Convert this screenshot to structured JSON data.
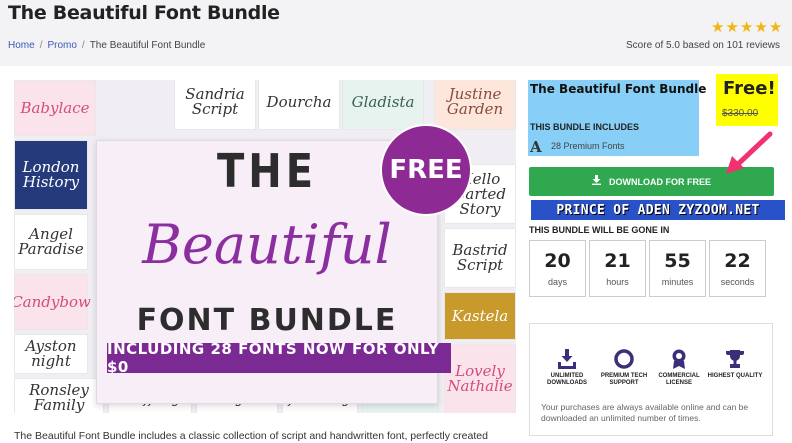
{
  "page": {
    "title": "The Beautiful Font Bundle",
    "rating_stars": 5,
    "score_text": "Score of 5.0 based on 101 reviews"
  },
  "breadcrumb": [
    "Home",
    "Promo",
    "The Beautiful Font Bundle"
  ],
  "promo_image": {
    "line1": "THE",
    "line2": "Beautiful",
    "line3": "FONT BUNDLE",
    "banner": "INCLUDING 28 FONTS NOW FOR ONLY $0",
    "badge": "FREE",
    "tiles": [
      "Babylace",
      "Sandria Script",
      "Dourcha",
      "Gladista",
      "Justine Garden",
      "London History",
      "Angel Paradise",
      "Candybow",
      "Hello Carted Story",
      "Bastrid Script",
      "Ayston night",
      "Kastela",
      "Ronsley Family",
      "Shiffany",
      "Abiyah",
      "fair lady",
      "Baby Dualistic",
      "Lovely Nathalie"
    ]
  },
  "bundle": {
    "title": "The Beautiful Font Bundle",
    "includes_label": "THIS BUNDLE INCLUDES",
    "fonts_icon": "A",
    "fonts_count": "28 Premium Fonts",
    "price_free": "Free!",
    "price_old": "$330.00",
    "download_label": "DOWNLOAD FOR FREE",
    "download_icon": "download-icon",
    "watermark": "PRINCE OF ADEN ZYZOOM.NET",
    "gone_label": "THIS BUNDLE WILL BE GONE IN",
    "countdown": [
      {
        "value": "20",
        "unit": "days"
      },
      {
        "value": "21",
        "unit": "hours"
      },
      {
        "value": "55",
        "unit": "minutes"
      },
      {
        "value": "22",
        "unit": "seconds"
      }
    ]
  },
  "features": [
    {
      "label": "UNLIMITED DOWNLOADS",
      "icon": "download-tray-icon"
    },
    {
      "label": "PREMIUM TECH SUPPORT",
      "icon": "lifebuoy-icon"
    },
    {
      "label": "COMMERCIAL LICENSE",
      "icon": "award-icon"
    },
    {
      "label": "HIGHEST QUALITY",
      "icon": "trophy-icon"
    }
  ],
  "features_note": "Your purchases are always available online and can be downloaded an unlimited number of times.",
  "description": "The Beautiful Font Bundle includes a classic collection of script and handwritten font, perfectly created",
  "colors": {
    "accent_purple": "#8e2a94",
    "download_green": "#2fa84f",
    "star_gold": "#f3b513",
    "highlight_blue": "#87cff6",
    "highlight_yellow": "#ffff00",
    "feature_icon": "#3c2f7a",
    "arrow_pink": "#f0326e"
  }
}
